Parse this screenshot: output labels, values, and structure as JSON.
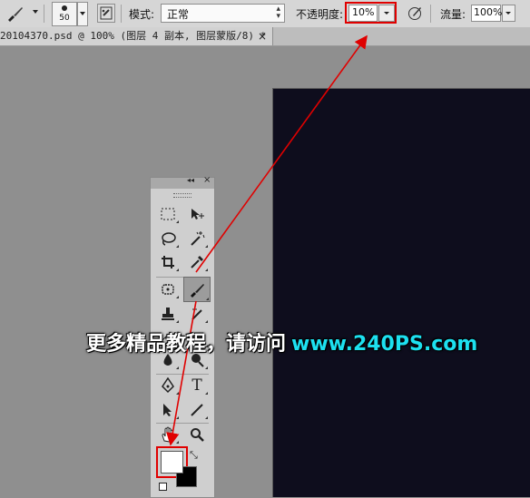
{
  "options_bar": {
    "brush_size": "50",
    "mode_label": "模式:",
    "mode_value": "正常",
    "opacity_label": "不透明度:",
    "opacity_value": "10%",
    "flow_label": "流量:",
    "flow_value": "100%"
  },
  "document_tab": {
    "title": "20104370.psd @ 100% (图层 4 副本, 图层蒙版/8) *",
    "close": "×"
  },
  "toolbox": {
    "collapse": "◂◂",
    "close": "×",
    "type_tool": "T",
    "highlighted_tool": "brush-tool"
  },
  "watermark": {
    "text": "更多精品教程，请访问",
    "url": "www.240PS.com"
  },
  "colors": {
    "highlight": "#e00000",
    "canvas": "#0e0d1d",
    "watermark_url": "#1de0f0",
    "foreground_color": "#ffffff",
    "background_color": "#000000"
  }
}
